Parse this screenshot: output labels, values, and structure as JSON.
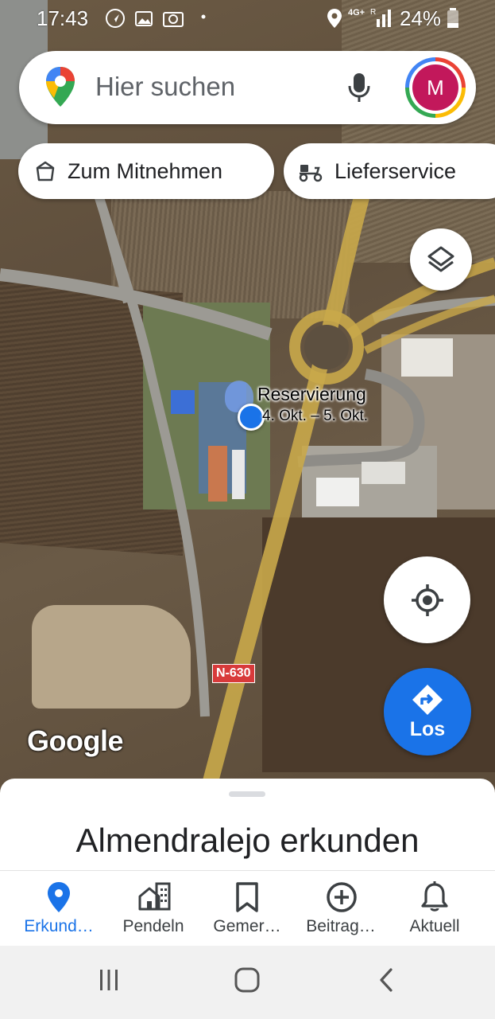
{
  "status_bar": {
    "time": "17:43",
    "network": "4G+",
    "network_sub": "R",
    "battery": "24%"
  },
  "search": {
    "placeholder": "Hier suchen",
    "avatar_initial": "M"
  },
  "chips": [
    {
      "label": "Zum Mitnehmen",
      "icon": "takeout-bag-icon"
    },
    {
      "label": "Lieferservice",
      "icon": "scooter-icon"
    }
  ],
  "map": {
    "reservation_label": "Reservierung",
    "reservation_dates": "4. Okt. – 5. Okt.",
    "road_sign": "N-630",
    "logo": "Google"
  },
  "map_buttons": {
    "layers_icon": "layers-icon",
    "my_location_icon": "crosshair-icon",
    "directions_label": "Los"
  },
  "bottom_sheet": {
    "title": "Almendralejo erkunden"
  },
  "bottom_nav": [
    {
      "label": "Erkund…",
      "icon": "location-pin-icon",
      "active": true
    },
    {
      "label": "Pendeln",
      "icon": "commute-icon",
      "active": false
    },
    {
      "label": "Gemer…",
      "icon": "bookmark-icon",
      "active": false
    },
    {
      "label": "Beitrag…",
      "icon": "add-circle-icon",
      "active": false
    },
    {
      "label": "Aktuell",
      "icon": "bell-icon",
      "active": false
    }
  ],
  "colors": {
    "accent": "#1a73e8",
    "avatar_bg": "#c2185b",
    "road_sign": "#d83a3a"
  }
}
